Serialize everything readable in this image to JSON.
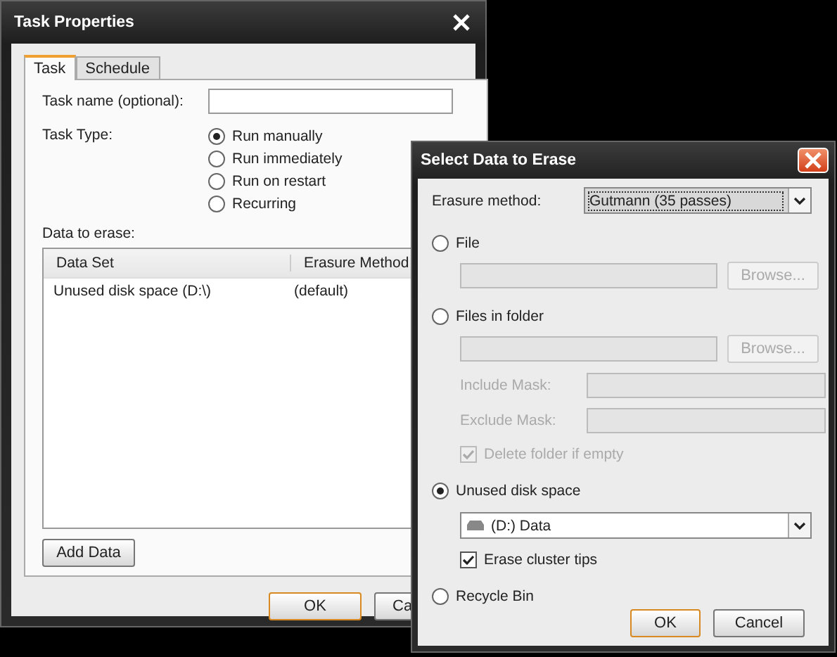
{
  "task_window": {
    "title": "Task Properties",
    "tabs": [
      {
        "label": "Task",
        "selected": true
      },
      {
        "label": "Schedule",
        "selected": false
      }
    ],
    "task_name": {
      "label": "Task name (optional):"
    },
    "task_type": {
      "label": "Task Type:",
      "options": [
        {
          "label": "Run manually",
          "selected": true
        },
        {
          "label": "Run immediately",
          "selected": false
        },
        {
          "label": "Run on restart",
          "selected": false
        },
        {
          "label": "Recurring",
          "selected": false
        }
      ]
    },
    "data_to_erase": {
      "label": "Data to erase:",
      "columns": [
        "Data Set",
        "Erasure Method"
      ],
      "rows": [
        {
          "cells": [
            "Unused disk space (D:\\)",
            "(default)"
          ]
        }
      ]
    },
    "add_button": "Add Data",
    "buttons": [
      {
        "label": "OK",
        "default": true
      },
      {
        "label": "Ca",
        "default": false
      }
    ]
  },
  "erase_dialog": {
    "title": "Select Data to Erase",
    "erasure_method": {
      "label": "Erasure method:",
      "value": "Gutmann (35 passes)"
    },
    "rows": [
      {
        "kind": "radio",
        "label": "File",
        "selected": false
      },
      {
        "kind": "path",
        "disabled": true,
        "button": "Browse..."
      },
      {
        "kind": "radio",
        "label": "Files in folder",
        "selected": false
      },
      {
        "kind": "path",
        "disabled": true,
        "button": "Browse..."
      },
      {
        "kind": "mask",
        "label": "Include Mask:",
        "disabled": true
      },
      {
        "kind": "mask",
        "label": "Exclude Mask:",
        "disabled": true
      },
      {
        "kind": "checkbox",
        "label": "Delete folder if empty",
        "checked": true,
        "disabled": true
      },
      {
        "kind": "radio",
        "label": "Unused disk space",
        "selected": true
      },
      {
        "kind": "drive",
        "value": "(D:) Data"
      },
      {
        "kind": "checkbox",
        "label": "Erase cluster tips",
        "checked": true,
        "disabled": false
      },
      {
        "kind": "radio",
        "label": "Recycle Bin",
        "selected": false
      }
    ],
    "buttons": [
      {
        "label": "OK",
        "default": true
      },
      {
        "label": "Cancel",
        "default": false
      }
    ]
  }
}
